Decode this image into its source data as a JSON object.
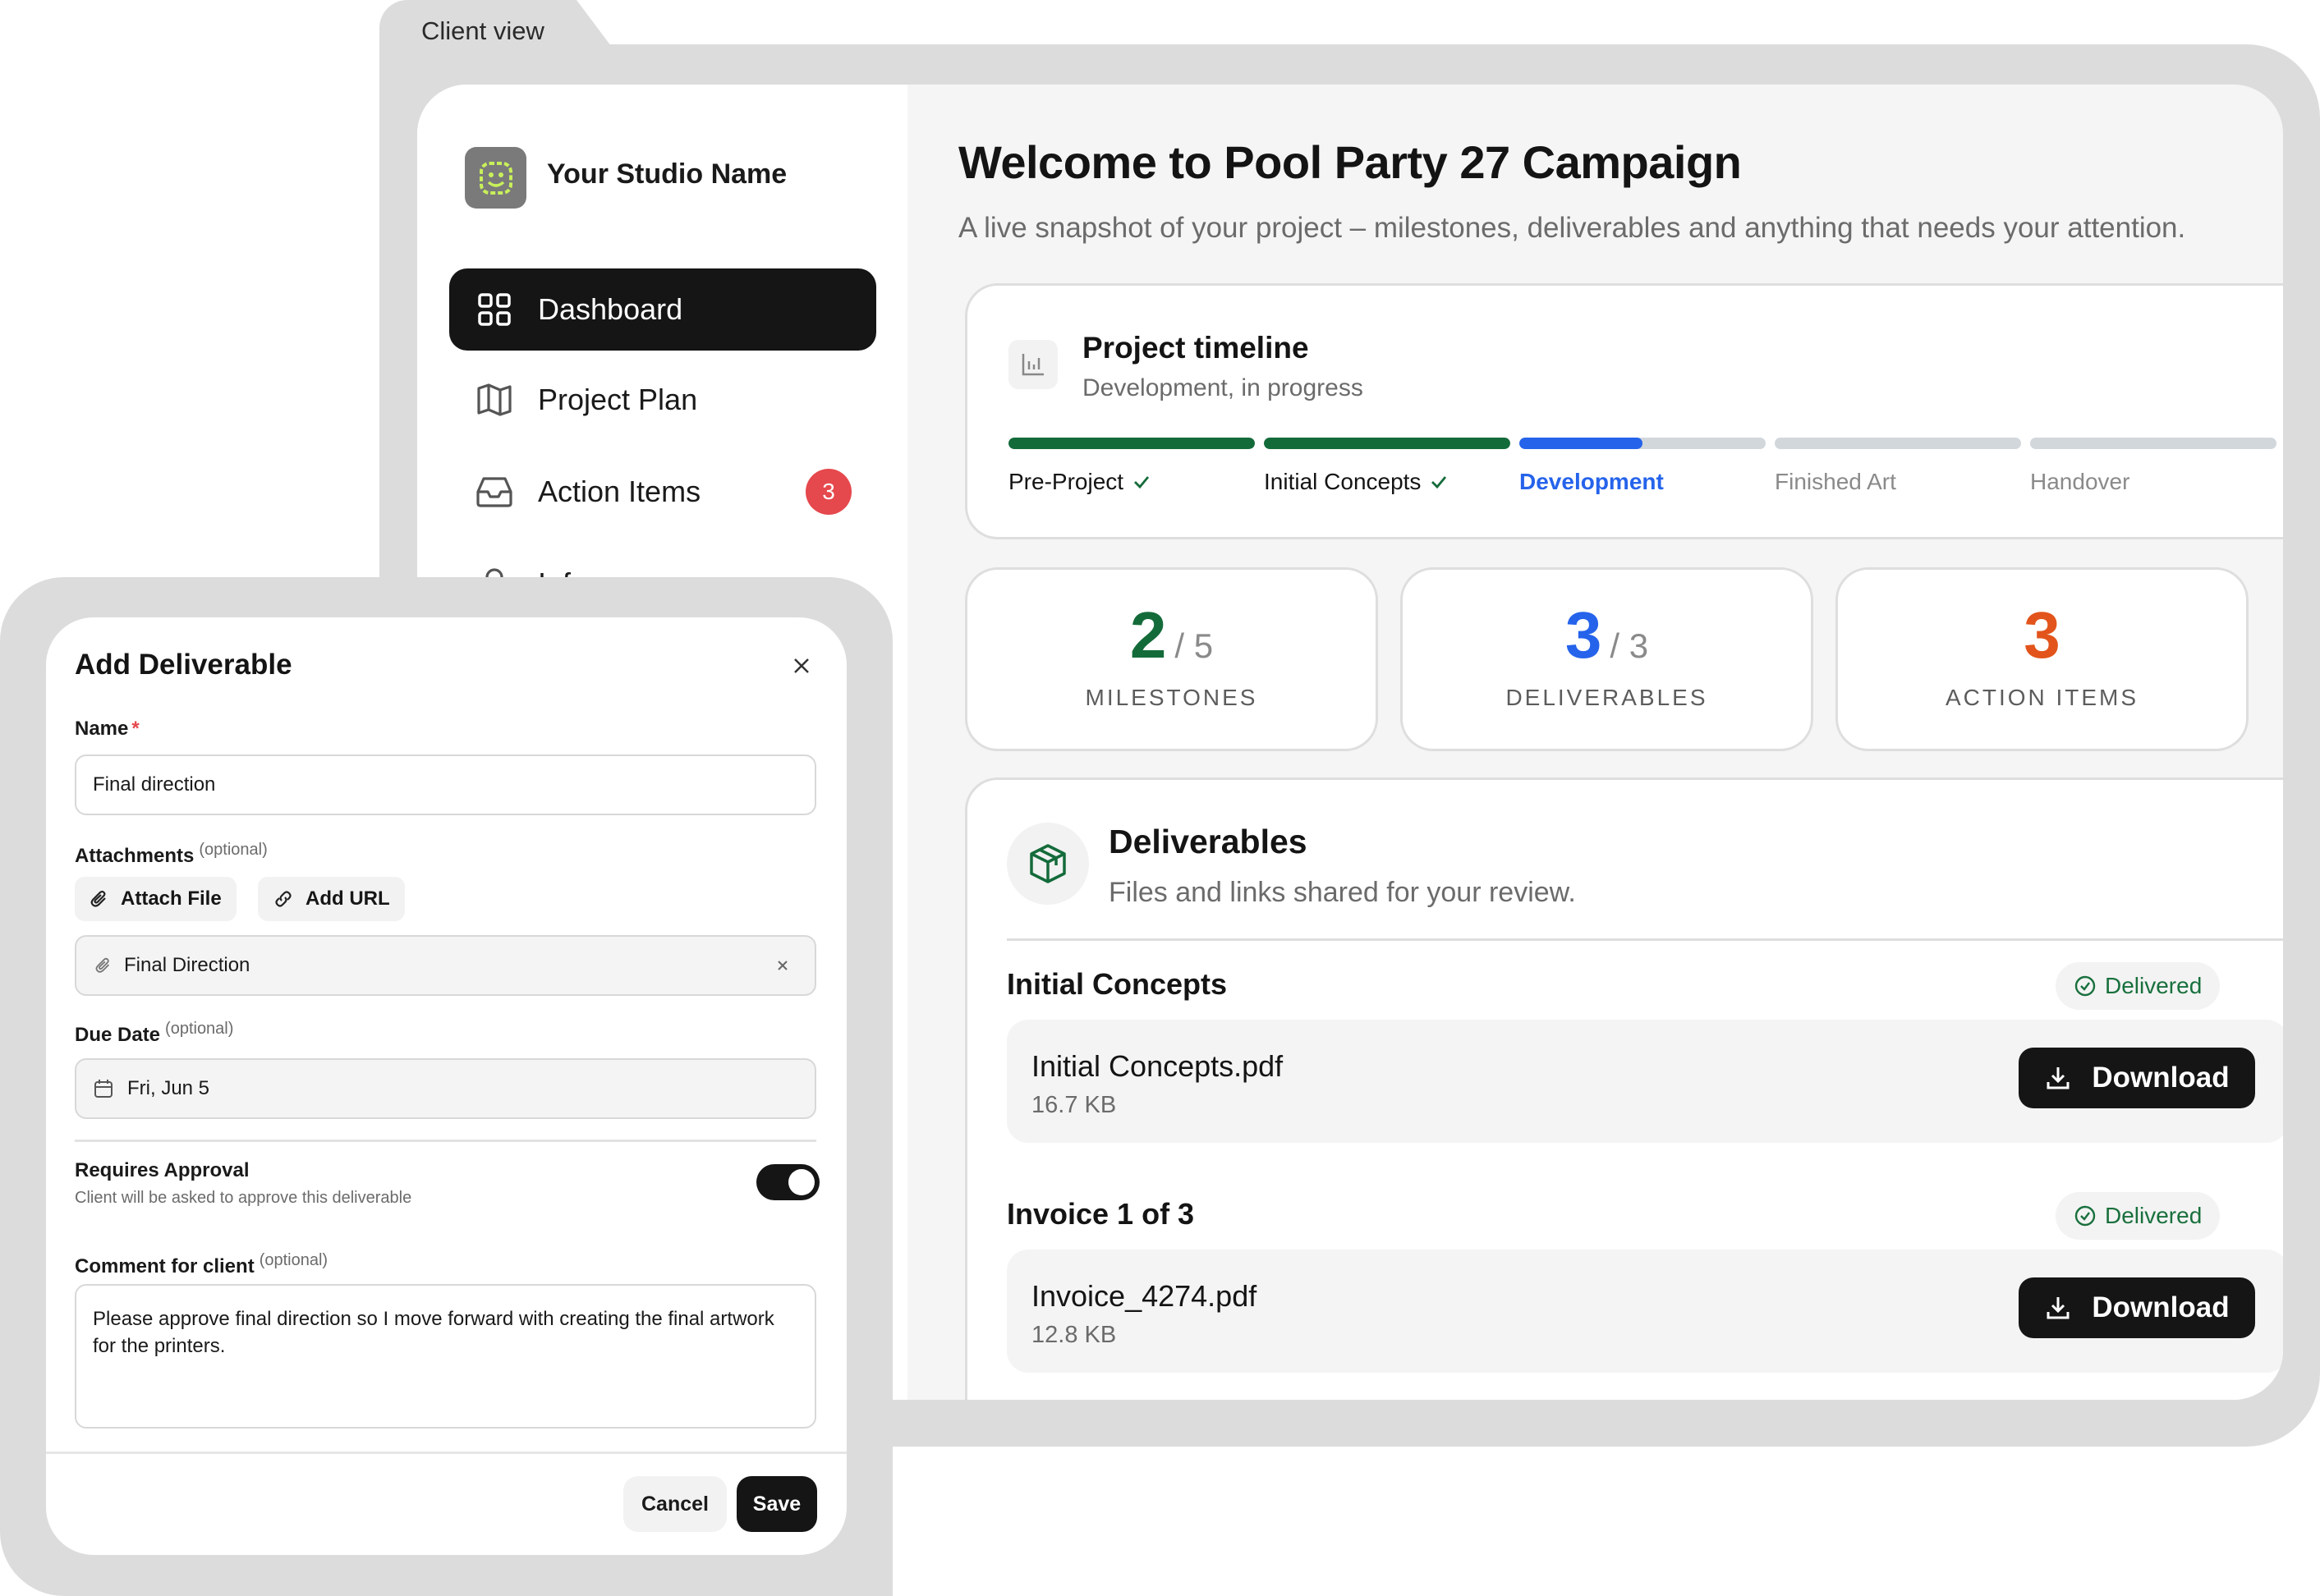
{
  "window": {
    "title": "Client view"
  },
  "sidebar": {
    "studio_name": "Your Studio Name",
    "logo_icon": "smiley-face-icon",
    "items": [
      {
        "label": "Dashboard",
        "icon": "grid-icon",
        "active": true
      },
      {
        "label": "Project Plan",
        "icon": "map-icon"
      },
      {
        "label": "Action Items",
        "icon": "inbox-icon",
        "badge": "3"
      },
      {
        "label": "Info",
        "icon": "person-icon"
      }
    ]
  },
  "header": {
    "title": "Welcome to Pool Party 27 Campaign",
    "subtitle": "A live snapshot of your project – milestones, deliverables and anything that needs your attention."
  },
  "timeline": {
    "title": "Project timeline",
    "status": "Development, in progress",
    "icon": "bar-chart-icon",
    "phases": [
      {
        "label": "Pre-Project",
        "state": "done",
        "progress": 1.0
      },
      {
        "label": "Initial Concepts",
        "state": "done",
        "progress": 1.0
      },
      {
        "label": "Development",
        "state": "current",
        "progress": 0.5
      },
      {
        "label": "Finished Art",
        "state": "pending",
        "progress": 0
      },
      {
        "label": "Handover",
        "state": "pending",
        "progress": 0
      }
    ],
    "colors": {
      "done": "#146b3a",
      "current": "#2563eb",
      "pending": "#d2d7dc"
    }
  },
  "stats": [
    {
      "value": "2",
      "total": "/ 5",
      "label": "MILESTONES",
      "color": "#146b3a"
    },
    {
      "value": "3",
      "total": "/ 3",
      "label": "DELIVERABLES",
      "color": "#2563eb"
    },
    {
      "value": "3",
      "total": "",
      "label": "ACTION ITEMS",
      "color": "#e2541b"
    }
  ],
  "deliverables": {
    "title": "Deliverables",
    "subtitle": "Files and links shared for your review.",
    "icon": "package-icon",
    "groups": [
      {
        "name": "Initial Concepts",
        "status": "Delivered",
        "file": "Initial Concepts.pdf",
        "size": "16.7 KB",
        "action": "Download"
      },
      {
        "name": "Invoice 1 of 3",
        "status": "Delivered",
        "file": "Invoice_4274.pdf",
        "size": "12.8 KB",
        "action": "Download"
      }
    ]
  },
  "modal": {
    "title": "Add Deliverable",
    "name_label": "Name",
    "name_value": "Final direction",
    "attachments_label": "Attachments",
    "optional": "(optional)",
    "attach_file": "Attach File",
    "add_url": "Add URL",
    "attachment_name": "Final Direction",
    "due_label": "Due Date",
    "due_value": "Fri, Jun 5",
    "approval_label": "Requires Approval",
    "approval_help": "Client will be asked to approve this deliverable",
    "approval_on": true,
    "comment_label": "Comment for client",
    "comment_value": "Please approve final direction so I move forward with creating the final artwork for the printers.",
    "cancel": "Cancel",
    "save": "Save"
  }
}
